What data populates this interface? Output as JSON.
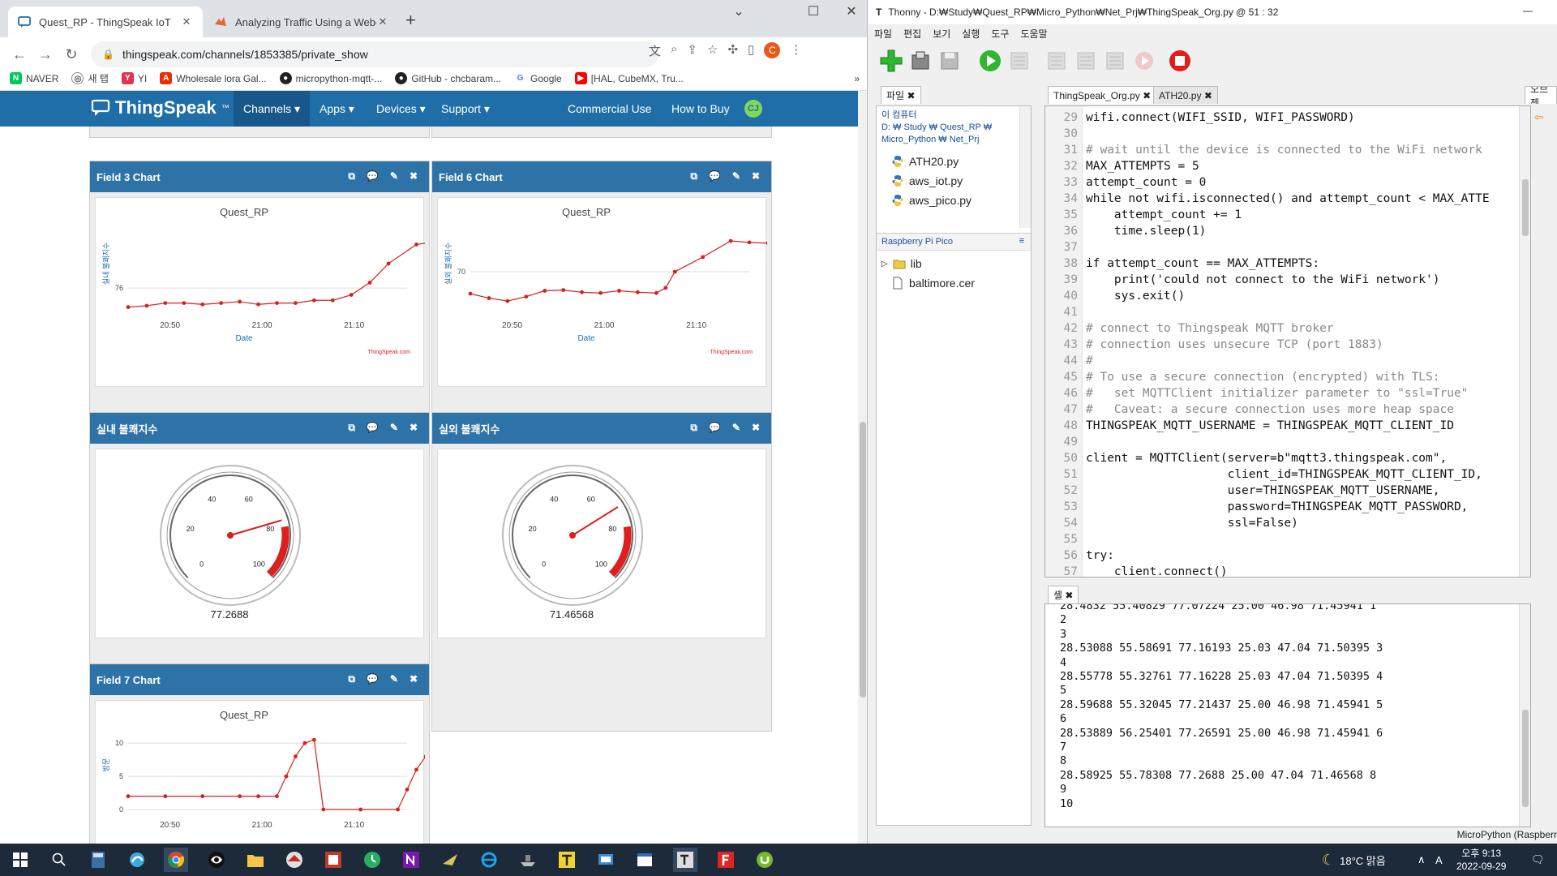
{
  "browser": {
    "tabs": [
      {
        "title": "Quest_RP - ThingSpeak IoT",
        "active": true
      },
      {
        "title": "Analyzing Traffic Using a Webca",
        "active": false
      }
    ],
    "url": "thingspeak.com/channels/1853385/private_show",
    "profile_initial": "C",
    "bookmarks": [
      "NAVER",
      "새 탭",
      "YI",
      "Wholesale lora Gal...",
      "micropython-mqtt-...",
      "GitHub - chcbaram...",
      "Google",
      "[HAL, CubeMX, Tru..."
    ]
  },
  "thingspeak": {
    "logo": "ThingSpeak",
    "logo_tm": "™",
    "menu": [
      "Channels ▾",
      "Apps ▾",
      "Devices ▾",
      "Support ▾"
    ],
    "right_menu": [
      "Commercial Use",
      "How to Buy"
    ],
    "avatar": "CJ",
    "widgets": {
      "f3": {
        "title": "Field 3 Chart"
      },
      "f6": {
        "title": "Field 6 Chart"
      },
      "g1": {
        "title": "실내 불쾌지수",
        "value": "77.2688"
      },
      "g2": {
        "title": "실외 불쾌지수",
        "value": "71.46568"
      },
      "f7": {
        "title": "Field 7 Chart"
      }
    },
    "watermark": "ThingSpeak.com"
  },
  "chart_data": [
    {
      "type": "line",
      "title": "Quest_RP",
      "xlabel": "Date",
      "ylabel": "실내 불쾌지수",
      "x_ticks": [
        "20:50",
        "21:00",
        "21:10"
      ],
      "y_ticks": [
        76
      ],
      "x_range_min": [
        0,
        30
      ],
      "ylim": [
        75.2,
        78.0
      ],
      "color": "#d62020",
      "points": [
        [
          0,
          75.3
        ],
        [
          2,
          75.35
        ],
        [
          4,
          75.45
        ],
        [
          6,
          75.45
        ],
        [
          8,
          75.4
        ],
        [
          10,
          75.45
        ],
        [
          12,
          75.5
        ],
        [
          14,
          75.4
        ],
        [
          16,
          75.45
        ],
        [
          18,
          75.45
        ],
        [
          20,
          75.55
        ],
        [
          22,
          75.55
        ],
        [
          24,
          75.75
        ],
        [
          26,
          76.2
        ],
        [
          28,
          76.9
        ],
        [
          31,
          77.6
        ],
        [
          33,
          77.7
        ],
        [
          35,
          77.75
        ]
      ]
    },
    {
      "type": "line",
      "title": "Quest_RP",
      "xlabel": "Date",
      "ylabel": "실외 불쾌지수",
      "x_ticks": [
        "20:50",
        "21:00",
        "21:10"
      ],
      "y_ticks": [
        70
      ],
      "x_range_min": [
        -3,
        27
      ],
      "ylim": [
        67.4,
        72.6
      ],
      "color": "#d62020",
      "points": [
        [
          -3,
          68.5
        ],
        [
          -1,
          68.2
        ],
        [
          1,
          68.0
        ],
        [
          3,
          68.3
        ],
        [
          5,
          68.7
        ],
        [
          7,
          68.75
        ],
        [
          9,
          68.6
        ],
        [
          11,
          68.55
        ],
        [
          13,
          68.7
        ],
        [
          15,
          68.6
        ],
        [
          17,
          68.55
        ],
        [
          18,
          68.9
        ],
        [
          19,
          70.0
        ],
        [
          22,
          71.0
        ],
        [
          25,
          72.1
        ],
        [
          27,
          72.0
        ],
        [
          29,
          71.95
        ]
      ]
    },
    {
      "type": "line",
      "title": "Quest_RP",
      "xlabel": "",
      "ylabel": "방문",
      "x_ticks": [
        "20:50",
        "21:00",
        "21:10"
      ],
      "y_ticks": [
        0,
        5,
        10
      ],
      "x_range_min": [
        0,
        30
      ],
      "ylim": [
        0,
        11
      ],
      "color": "#d62020",
      "points": [
        [
          0,
          2
        ],
        [
          4,
          2
        ],
        [
          8,
          2
        ],
        [
          12,
          2
        ],
        [
          14,
          2
        ],
        [
          16,
          2
        ],
        [
          17,
          5
        ],
        [
          18,
          8
        ],
        [
          19,
          10
        ],
        [
          20,
          10.5
        ],
        [
          21,
          0
        ],
        [
          25,
          0
        ],
        [
          29,
          0
        ],
        [
          30,
          3
        ],
        [
          31,
          6
        ],
        [
          32,
          8
        ]
      ]
    },
    {
      "type": "gauge",
      "title": "실내 불쾌지수",
      "value": 77.2688,
      "min": 0,
      "max": 100,
      "ticks": [
        0,
        20,
        40,
        60,
        80,
        100
      ],
      "danger_from": 80
    },
    {
      "type": "gauge",
      "title": "실외 불쾌지수",
      "value": 71.46568,
      "min": 0,
      "max": 100,
      "ticks": [
        0,
        20,
        40,
        60,
        80,
        100
      ],
      "danger_from": 80
    }
  ],
  "thonny": {
    "title": "Thonny  -  D:₩Study₩Quest_RP₩Micro_Python₩Net_Prj₩ThingSpeak_Org.py  @  51 : 32",
    "menu": [
      "파일",
      "편집",
      "보기",
      "실행",
      "도구",
      "도움말"
    ],
    "files_tab": "파일",
    "path": "이 컴퓨터\nD: ₩ Study ₩ Quest_RP ₩\nMicro_Python ₩ Net_Prj",
    "local_files": [
      "ATH20.py",
      "aws_iot.py",
      "aws_pico.py"
    ],
    "pico_header": "Raspberry Pi Pico",
    "pico_files": [
      "lib",
      "baltimore.cer"
    ],
    "editor_tabs": [
      "ThingSpeak_Org.py",
      "ATH20.py"
    ],
    "right_tab": "오브젝",
    "code": [
      {
        "n": "29",
        "t": "wifi.connect(WIFI_SSID, WIFI_PASSWORD)"
      },
      {
        "n": "30",
        "t": ""
      },
      {
        "n": "31",
        "t": "# wait until the device is connected to the WiFi network"
      },
      {
        "n": "32",
        "t": "MAX_ATTEMPTS = 5"
      },
      {
        "n": "33",
        "t": "attempt_count = 0"
      },
      {
        "n": "34",
        "t": "while not wifi.isconnected() and attempt_count < MAX_ATTE"
      },
      {
        "n": "35",
        "t": "    attempt_count += 1"
      },
      {
        "n": "36",
        "t": "    time.sleep(1)"
      },
      {
        "n": "37",
        "t": ""
      },
      {
        "n": "38",
        "t": "if attempt_count == MAX_ATTEMPTS:"
      },
      {
        "n": "39",
        "t": "    print('could not connect to the WiFi network')"
      },
      {
        "n": "40",
        "t": "    sys.exit()"
      },
      {
        "n": "41",
        "t": ""
      },
      {
        "n": "42",
        "t": "# connect to Thingspeak MQTT broker"
      },
      {
        "n": "43",
        "t": "# connection uses unsecure TCP (port 1883)"
      },
      {
        "n": "44",
        "t": "#"
      },
      {
        "n": "45",
        "t": "# To use a secure connection (encrypted) with TLS:"
      },
      {
        "n": "46",
        "t": "#   set MQTTClient initializer parameter to \"ssl=True\""
      },
      {
        "n": "47",
        "t": "#   Caveat: a secure connection uses more heap space"
      },
      {
        "n": "48",
        "t": "THINGSPEAK_MQTT_USERNAME = THINGSPEAK_MQTT_CLIENT_ID"
      },
      {
        "n": "49",
        "t": ""
      },
      {
        "n": "50",
        "t": "client = MQTTClient(server=b\"mqtt3.thingspeak.com\","
      },
      {
        "n": "51",
        "t": "                    client_id=THINGSPEAK_MQTT_CLIENT_ID,"
      },
      {
        "n": "52",
        "t": "                    user=THINGSPEAK_MQTT_USERNAME,"
      },
      {
        "n": "53",
        "t": "                    password=THINGSPEAK_MQTT_PASSWORD,"
      },
      {
        "n": "54",
        "t": "                    ssl=False)"
      },
      {
        "n": "55",
        "t": ""
      },
      {
        "n": "56",
        "t": "try:"
      },
      {
        "n": "57",
        "t": "    client.connect()"
      }
    ],
    "shell_tab": "셸",
    "shell": [
      "28.4832 55.40829 77.07224 25.00 46.98 71.45941 1",
      "2",
      "3",
      "28.53088 55.58691 77.16193 25.03 47.04 71.50395 3",
      "4",
      "28.55778 55.32761 77.16228 25.03 47.04 71.50395 4",
      "5",
      "28.59688 55.32045 77.21437 25.00 46.98 71.45941 5",
      "6",
      "28.53889 56.25401 77.26591 25.00 46.98 71.45941 6",
      "7",
      "8",
      "28.58925 55.78308 77.2688 25.00 47.04 71.46568 8",
      "9",
      "10"
    ],
    "status": "MicroPython (Raspberr"
  },
  "taskbar": {
    "weather": "18°C 맑음",
    "ime": "A",
    "time": "오후 9:13",
    "date": "2022-09-29"
  }
}
